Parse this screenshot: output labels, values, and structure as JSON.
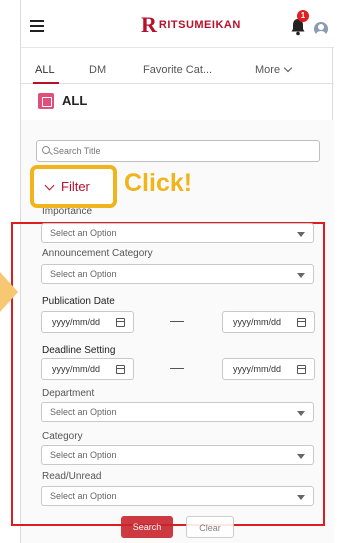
{
  "header": {
    "logo_letter": "R",
    "logo_text": "RITSUMEIKAN",
    "notification_count": "1",
    "colors": {
      "brand": "#b8102a",
      "highlight": "#f0b41c",
      "annotation_box": "#dc1e1e"
    }
  },
  "tabs": [
    {
      "label": "ALL",
      "active": true
    },
    {
      "label": "DM",
      "active": false
    },
    {
      "label": "Favorite Cat...",
      "active": false
    },
    {
      "label": "More",
      "active": false
    }
  ],
  "list": {
    "title": "ALL"
  },
  "search": {
    "placeholder": "Search Title"
  },
  "filter": {
    "label": "Filter"
  },
  "annotation": {
    "click": "Click!"
  },
  "fields": {
    "importance": {
      "label": "Importance",
      "value": "Select an Option"
    },
    "announcement_category": {
      "label": "Announcement Category",
      "value": "Select an Option"
    },
    "publication_date": {
      "label": "Publication Date",
      "from": "yyyy/mm/dd",
      "to": "yyyy/mm/dd"
    },
    "deadline_setting": {
      "label": "Deadline Setting",
      "from": "yyyy/mm/dd",
      "to": "yyyy/mm/dd"
    },
    "department": {
      "label": "Department",
      "value": "Select an Option"
    },
    "category": {
      "label": "Category",
      "value": "Select an Option"
    },
    "read_unread": {
      "label": "Read/Unread",
      "value": "Select an Option"
    }
  },
  "buttons": {
    "search": "Search",
    "clear": "Clear"
  }
}
